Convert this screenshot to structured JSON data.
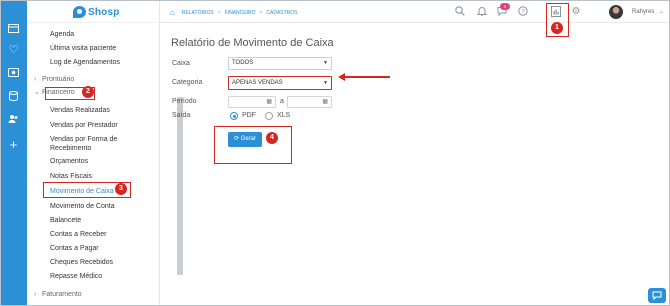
{
  "brand": {
    "name": "Shosp"
  },
  "breadcrumb": [
    "RELATÓRIOS",
    "FINANCEIRO",
    "CADASTROS"
  ],
  "header": {
    "notification_count": "0",
    "user_name": "Rahyres"
  },
  "sidebar": {
    "items_top": [
      "Agenda",
      "Última visita paciente",
      "Log de Agendamentos"
    ],
    "group_prontuario": "Prontuário",
    "group_financeiro": "Financeiro",
    "financeiro_items": [
      "Vendas Realizadas",
      "Vendas por Prestador",
      "Vendas por Forma de Recebimento",
      "Orçamentos",
      "Notas Fiscais",
      "Movimento de Caixa",
      "Movimento de Conta",
      "Balancete",
      "Contas a Receber",
      "Contas a Pagar",
      "Cheques Recebidos",
      "Repasse Médico"
    ],
    "group_faturamento": "Faturamento"
  },
  "page": {
    "title": "Relatório de Movimento de Caixa",
    "labels": {
      "caixa": "Caixa",
      "categoria": "Categoria",
      "periodo": "Período",
      "saida": "Saída"
    },
    "caixa_value": "TODOS",
    "categoria_value": "APENAS VENDAS",
    "periodo_separator": "a",
    "saida_options": [
      "PDF",
      "XLS"
    ],
    "saida_selected": "PDF",
    "generate_label": "Gerar"
  },
  "annotations": [
    "1",
    "2",
    "3",
    "4"
  ],
  "colors": {
    "accent": "#2c90d6",
    "annotation": "#d9251f",
    "badge": "#e0427d"
  }
}
